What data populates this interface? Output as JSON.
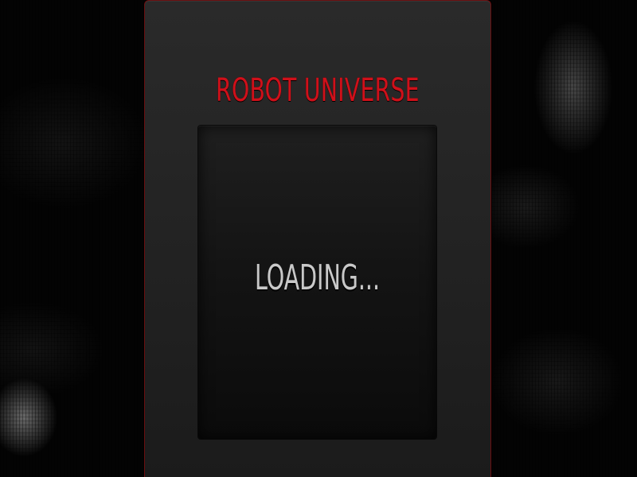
{
  "game": {
    "title": "ROBOT UNIVERSE",
    "loading_text": "LOADING...",
    "colors": {
      "accent_red": "#d0101a",
      "panel_border": "#6b0f10",
      "panel_bg": "#242424",
      "screen_bg": "#111111",
      "loading_text": "#c9c9c9"
    }
  }
}
